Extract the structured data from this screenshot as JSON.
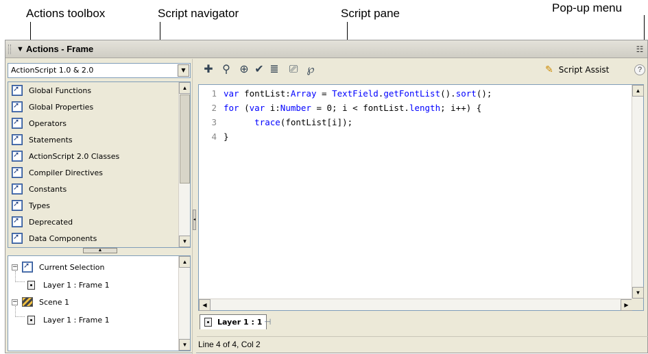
{
  "callouts": {
    "actions_toolbox": "Actions toolbox",
    "script_navigator": "Script navigator",
    "script_pane": "Script pane",
    "popup_menu": "Pop-up menu"
  },
  "panel": {
    "title": "Actions - Frame",
    "collapse_glyph": "▼",
    "popup_glyph": "☷"
  },
  "version_select": {
    "value": "ActionScript 1.0 & 2.0",
    "arrow": "▼"
  },
  "toolbox_items": [
    {
      "label": "Global Functions"
    },
    {
      "label": "Global Properties"
    },
    {
      "label": "Operators"
    },
    {
      "label": "Statements"
    },
    {
      "label": "ActionScript 2.0 Classes"
    },
    {
      "label": "Compiler Directives"
    },
    {
      "label": "Constants"
    },
    {
      "label": "Types"
    },
    {
      "label": "Deprecated"
    },
    {
      "label": "Data Components"
    }
  ],
  "navigator": {
    "current_selection": "Current Selection",
    "current_child": "Layer 1 : Frame 1",
    "scene": "Scene 1",
    "scene_child": "Layer 1 : Frame 1",
    "collapse_glyph": "−"
  },
  "toolbar": {
    "icons": [
      {
        "name": "add-item-icon",
        "glyph": "✚"
      },
      {
        "name": "find-icon",
        "glyph": "⚲"
      },
      {
        "name": "target-path-icon",
        "glyph": "⊕"
      },
      {
        "name": "check-syntax-icon",
        "glyph": "✔"
      },
      {
        "name": "auto-format-icon",
        "glyph": "≣"
      },
      {
        "name": "code-hint-icon",
        "glyph": "⎚"
      },
      {
        "name": "debug-options-icon",
        "glyph": "℘"
      }
    ],
    "script_assist_label": "Script Assist",
    "help_glyph": "?"
  },
  "script": {
    "lines": [
      {
        "num": "1",
        "text": "var fontList:Array = TextField.getFontList().sort();"
      },
      {
        "num": "2",
        "text": "for (var i:Number = 0; i < fontList.length; i++) {"
      },
      {
        "num": "3",
        "text": "      trace(fontList[i]);"
      },
      {
        "num": "4",
        "text": "}"
      }
    ]
  },
  "tab": {
    "label": "Layer 1 : 1",
    "pin_glyph": "⊣"
  },
  "status": {
    "text": "Line 4 of 4, Col 2"
  },
  "colors": {
    "keyword": "#0000ff",
    "panel_bg": "#ece9d8",
    "line_number": "#888888"
  }
}
